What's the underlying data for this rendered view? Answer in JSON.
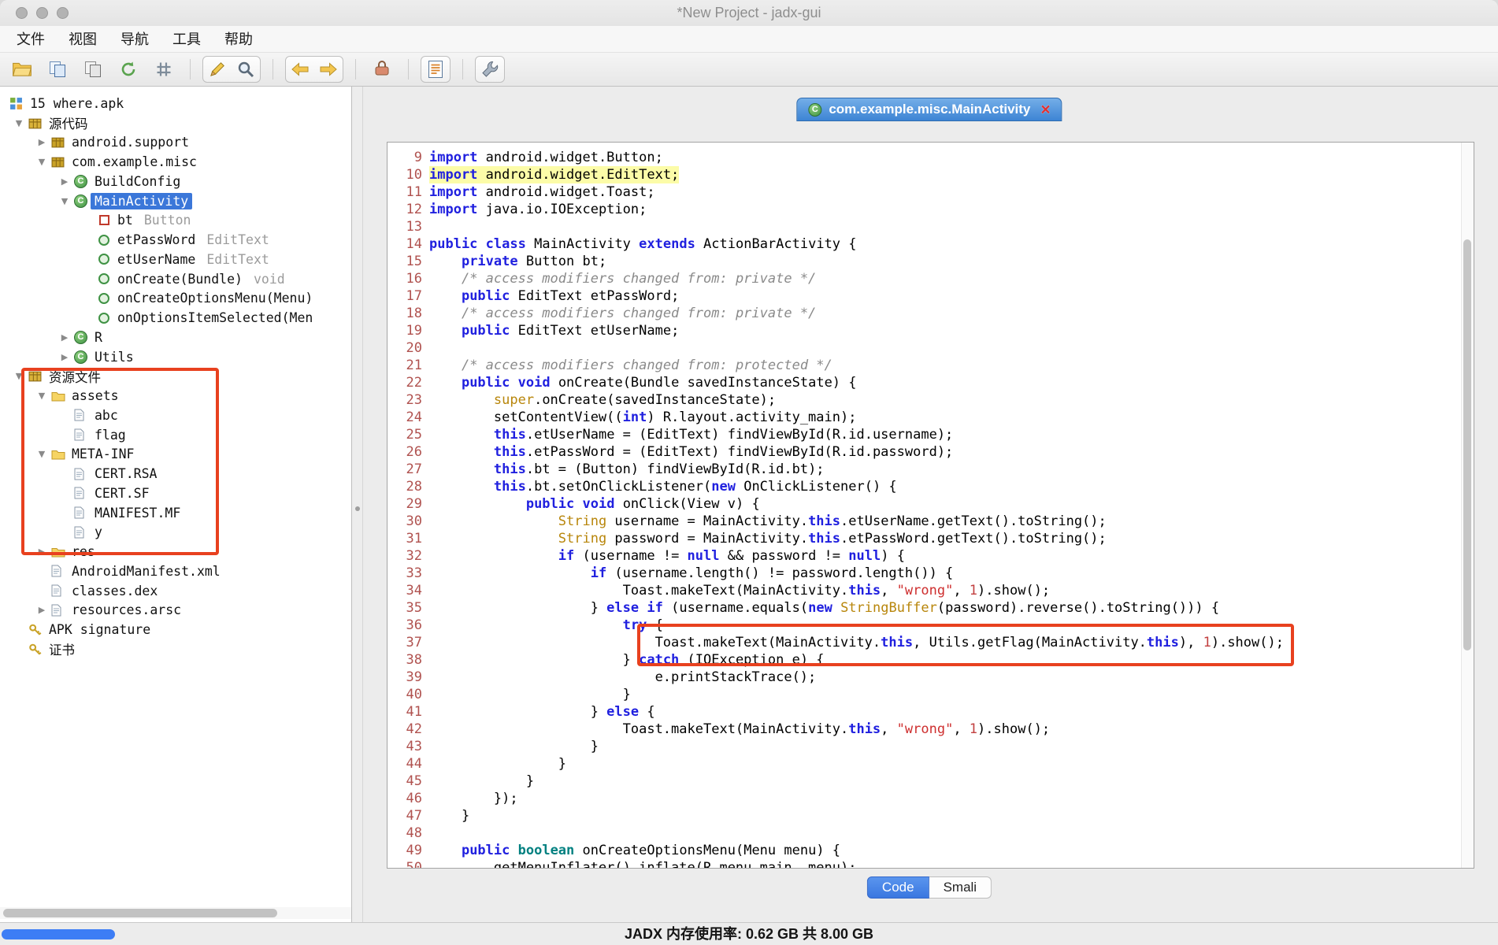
{
  "window": {
    "title": "*New Project - jadx-gui"
  },
  "menubar": {
    "items": [
      "文件",
      "视图",
      "导航",
      "工具",
      "帮助"
    ]
  },
  "toolbar": {
    "items": [
      {
        "name": "open-file-button",
        "icon": "folder"
      },
      {
        "name": "save-all-button",
        "icon": "save-all"
      },
      {
        "name": "export-button",
        "icon": "export"
      },
      {
        "name": "reload-button",
        "icon": "sync"
      },
      {
        "name": "flatten-packages-button",
        "icon": "flatten"
      },
      {
        "sep": true
      },
      {
        "name": "deobfuscation-button",
        "icon": "pencil",
        "group": "edit"
      },
      {
        "name": "search-button",
        "icon": "search",
        "group": "edit"
      },
      {
        "sep": true
      },
      {
        "name": "back-button",
        "icon": "arrow-left",
        "group": "nav"
      },
      {
        "name": "forward-button",
        "icon": "arrow-right",
        "group": "nav"
      },
      {
        "sep": true
      },
      {
        "name": "quark-button",
        "icon": "bag"
      },
      {
        "sep": true
      },
      {
        "name": "log-viewer-button",
        "icon": "log",
        "group": "log"
      },
      {
        "sep": true
      },
      {
        "name": "preferences-button",
        "icon": "wrench",
        "group": "prefs"
      }
    ]
  },
  "tree": {
    "items": [
      {
        "label": "15 where.apk",
        "level": 0,
        "icon": "apk",
        "root": true
      },
      {
        "label": "源代码",
        "level": 0,
        "icon": "source-package",
        "arrow": "open"
      },
      {
        "label": "android.support",
        "level": 1,
        "icon": "package",
        "arrow": "closed"
      },
      {
        "label": "com.example.misc",
        "level": 1,
        "icon": "package",
        "arrow": "open"
      },
      {
        "label": "BuildConfig",
        "level": 2,
        "icon": "class",
        "arrow": "closed"
      },
      {
        "label": "MainActivity",
        "level": 2,
        "icon": "class",
        "arrow": "open",
        "selected": true
      },
      {
        "label": "bt",
        "sub": "Button",
        "level": 3,
        "icon": "field"
      },
      {
        "label": "etPassWord",
        "sub": "EditText",
        "level": 3,
        "icon": "method"
      },
      {
        "label": "etUserName",
        "sub": "EditText",
        "level": 3,
        "icon": "method"
      },
      {
        "label": "onCreate(Bundle)",
        "sub": "void",
        "level": 3,
        "icon": "method"
      },
      {
        "label": "onCreateOptionsMenu(Menu)",
        "level": 3,
        "icon": "method"
      },
      {
        "label": "onOptionsItemSelected(Men",
        "level": 3,
        "icon": "method"
      },
      {
        "label": "R",
        "level": 2,
        "icon": "class",
        "arrow": "closed"
      },
      {
        "label": "Utils",
        "level": 2,
        "icon": "class",
        "arrow": "closed"
      },
      {
        "label": "资源文件",
        "level": 0,
        "icon": "resource-package",
        "arrow": "open"
      },
      {
        "label": "assets",
        "level": 1,
        "icon": "folder",
        "arrow": "open"
      },
      {
        "label": "abc",
        "level": 2,
        "icon": "file"
      },
      {
        "label": "flag",
        "level": 2,
        "icon": "file"
      },
      {
        "label": "META-INF",
        "level": 1,
        "icon": "folder",
        "arrow": "open"
      },
      {
        "label": "CERT.RSA",
        "level": 2,
        "icon": "file"
      },
      {
        "label": "CERT.SF",
        "level": 2,
        "icon": "file"
      },
      {
        "label": "MANIFEST.MF",
        "level": 2,
        "icon": "file"
      },
      {
        "label": "y",
        "level": 2,
        "icon": "file"
      },
      {
        "label": "res",
        "level": 1,
        "icon": "folder",
        "arrow": "closed"
      },
      {
        "label": "AndroidManifest.xml",
        "level": 1,
        "icon": "file"
      },
      {
        "label": "classes.dex",
        "level": 1,
        "icon": "file"
      },
      {
        "label": "resources.arsc",
        "level": 1,
        "icon": "file",
        "arrow": "closed"
      },
      {
        "label": "APK signature",
        "level": 0,
        "icon": "key"
      },
      {
        "label": "证书",
        "level": 0,
        "icon": "key"
      }
    ]
  },
  "editor": {
    "tab_title": "com.example.misc.MainActivity",
    "close_icon": "×",
    "buttons": {
      "code": "Code",
      "smali": "Smali"
    },
    "lines": [
      {
        "n": 9,
        "seg": [
          [
            "k",
            "import"
          ],
          [
            "p",
            " android.widget.Button;"
          ]
        ]
      },
      {
        "n": 10,
        "hl": true,
        "seg": [
          [
            "k",
            "import"
          ],
          [
            "p",
            " android.widget.EditText;"
          ]
        ]
      },
      {
        "n": 11,
        "seg": [
          [
            "k",
            "import"
          ],
          [
            "p",
            " android.widget.Toast;"
          ]
        ]
      },
      {
        "n": 12,
        "seg": [
          [
            "k",
            "import"
          ],
          [
            "p",
            " java.io.IOException;"
          ]
        ]
      },
      {
        "n": 13,
        "seg": []
      },
      {
        "n": 14,
        "seg": [
          [
            "k",
            "public"
          ],
          [
            "p",
            " "
          ],
          [
            "k",
            "class"
          ],
          [
            "p",
            " MainActivity "
          ],
          [
            "k",
            "extends"
          ],
          [
            "p",
            " ActionBarActivity {"
          ]
        ]
      },
      {
        "n": 15,
        "seg": [
          [
            "p",
            "    "
          ],
          [
            "k",
            "private"
          ],
          [
            "p",
            " Button bt;"
          ]
        ]
      },
      {
        "n": 16,
        "seg": [
          [
            "p",
            "    "
          ],
          [
            "c",
            "/* access modifiers changed from: private */"
          ]
        ]
      },
      {
        "n": 17,
        "seg": [
          [
            "p",
            "    "
          ],
          [
            "k",
            "public"
          ],
          [
            "p",
            " EditText etPassWord;"
          ]
        ]
      },
      {
        "n": 18,
        "seg": [
          [
            "p",
            "    "
          ],
          [
            "c",
            "/* access modifiers changed from: private */"
          ]
        ]
      },
      {
        "n": 19,
        "seg": [
          [
            "p",
            "    "
          ],
          [
            "k",
            "public"
          ],
          [
            "p",
            " EditText etUserName;"
          ]
        ]
      },
      {
        "n": 20,
        "seg": []
      },
      {
        "n": 21,
        "seg": [
          [
            "p",
            "    "
          ],
          [
            "c",
            "/* access modifiers changed from: protected */"
          ]
        ]
      },
      {
        "n": 22,
        "seg": [
          [
            "p",
            "    "
          ],
          [
            "k",
            "public"
          ],
          [
            "p",
            " "
          ],
          [
            "k",
            "void"
          ],
          [
            "p",
            " onCreate(Bundle savedInstanceState) {"
          ]
        ]
      },
      {
        "n": 23,
        "seg": [
          [
            "p",
            "        "
          ],
          [
            "t",
            "super"
          ],
          [
            "p",
            ".onCreate(savedInstanceState);"
          ]
        ]
      },
      {
        "n": 24,
        "seg": [
          [
            "p",
            "        setContentView(("
          ],
          [
            "k",
            "int"
          ],
          [
            "p",
            ") R.layout.activity_main);"
          ]
        ]
      },
      {
        "n": 25,
        "seg": [
          [
            "p",
            "        "
          ],
          [
            "k",
            "this"
          ],
          [
            "p",
            ".etUserName = (EditText) findViewById(R.id.username);"
          ]
        ]
      },
      {
        "n": 26,
        "seg": [
          [
            "p",
            "        "
          ],
          [
            "k",
            "this"
          ],
          [
            "p",
            ".etPassWord = (EditText) findViewById(R.id.password);"
          ]
        ]
      },
      {
        "n": 27,
        "seg": [
          [
            "p",
            "        "
          ],
          [
            "k",
            "this"
          ],
          [
            "p",
            ".bt = (Button) findViewById(R.id.bt);"
          ]
        ]
      },
      {
        "n": 28,
        "seg": [
          [
            "p",
            "        "
          ],
          [
            "k",
            "this"
          ],
          [
            "p",
            ".bt.setOnClickListener("
          ],
          [
            "k",
            "new"
          ],
          [
            "p",
            " OnClickListener() {"
          ]
        ]
      },
      {
        "n": 29,
        "seg": [
          [
            "p",
            "            "
          ],
          [
            "k",
            "public"
          ],
          [
            "p",
            " "
          ],
          [
            "k",
            "void"
          ],
          [
            "p",
            " onClick(View v) {"
          ]
        ]
      },
      {
        "n": 30,
        "seg": [
          [
            "p",
            "                "
          ],
          [
            "t",
            "String"
          ],
          [
            "p",
            " username = MainActivity."
          ],
          [
            "k",
            "this"
          ],
          [
            "p",
            ".etUserName.getText().toString();"
          ]
        ]
      },
      {
        "n": 31,
        "seg": [
          [
            "p",
            "                "
          ],
          [
            "t",
            "String"
          ],
          [
            "p",
            " password = MainActivity."
          ],
          [
            "k",
            "this"
          ],
          [
            "p",
            ".etPassWord.getText().toString();"
          ]
        ]
      },
      {
        "n": 32,
        "seg": [
          [
            "p",
            "                "
          ],
          [
            "k",
            "if"
          ],
          [
            "p",
            " (username != "
          ],
          [
            "k",
            "null"
          ],
          [
            "p",
            " && password != "
          ],
          [
            "k",
            "null"
          ],
          [
            "p",
            ") {"
          ]
        ]
      },
      {
        "n": 33,
        "seg": [
          [
            "p",
            "                    "
          ],
          [
            "k",
            "if"
          ],
          [
            "p",
            " (username.length() != password.length()) {"
          ]
        ]
      },
      {
        "n": 34,
        "seg": [
          [
            "p",
            "                        Toast.makeText(MainActivity."
          ],
          [
            "k",
            "this"
          ],
          [
            "p",
            ", "
          ],
          [
            "s",
            "\"wrong\""
          ],
          [
            "p",
            ", "
          ],
          [
            "n",
            "1"
          ],
          [
            "p",
            ").show();"
          ]
        ]
      },
      {
        "n": 35,
        "seg": [
          [
            "p",
            "                    } "
          ],
          [
            "k",
            "else"
          ],
          [
            "p",
            " "
          ],
          [
            "k",
            "if"
          ],
          [
            "p",
            " (username.equals("
          ],
          [
            "k",
            "new"
          ],
          [
            "p",
            " "
          ],
          [
            "t",
            "StringBuffer"
          ],
          [
            "p",
            "(password).reverse().toString())) {"
          ]
        ]
      },
      {
        "n": 36,
        "seg": [
          [
            "p",
            "                        "
          ],
          [
            "k",
            "try"
          ],
          [
            "p",
            " {"
          ]
        ]
      },
      {
        "n": 37,
        "seg": [
          [
            "p",
            "                            Toast.makeText(MainActivity."
          ],
          [
            "k",
            "this"
          ],
          [
            "p",
            ", Utils.getFlag(MainActivity."
          ],
          [
            "k",
            "this"
          ],
          [
            "p",
            "), "
          ],
          [
            "n",
            "1"
          ],
          [
            "p",
            ").show();"
          ]
        ]
      },
      {
        "n": 38,
        "seg": [
          [
            "p",
            "                        } "
          ],
          [
            "k",
            "catch"
          ],
          [
            "p",
            " (IOException e) {"
          ]
        ]
      },
      {
        "n": 39,
        "seg": [
          [
            "p",
            "                            e.printStackTrace();"
          ]
        ]
      },
      {
        "n": 40,
        "seg": [
          [
            "p",
            "                        }"
          ]
        ]
      },
      {
        "n": 41,
        "seg": [
          [
            "p",
            "                    } "
          ],
          [
            "k",
            "else"
          ],
          [
            "p",
            " {"
          ]
        ]
      },
      {
        "n": 42,
        "seg": [
          [
            "p",
            "                        Toast.makeText(MainActivity."
          ],
          [
            "k",
            "this"
          ],
          [
            "p",
            ", "
          ],
          [
            "s",
            "\"wrong\""
          ],
          [
            "p",
            ", "
          ],
          [
            "n",
            "1"
          ],
          [
            "p",
            ").show();"
          ]
        ]
      },
      {
        "n": 43,
        "seg": [
          [
            "p",
            "                    }"
          ]
        ]
      },
      {
        "n": 44,
        "seg": [
          [
            "p",
            "                }"
          ]
        ]
      },
      {
        "n": 45,
        "seg": [
          [
            "p",
            "            }"
          ]
        ]
      },
      {
        "n": 46,
        "seg": [
          [
            "p",
            "        });"
          ]
        ]
      },
      {
        "n": 47,
        "seg": [
          [
            "p",
            "    }"
          ]
        ]
      },
      {
        "n": 48,
        "seg": []
      },
      {
        "n": 49,
        "seg": [
          [
            "p",
            "    "
          ],
          [
            "k",
            "public"
          ],
          [
            "p",
            " "
          ],
          [
            "d",
            "boolean"
          ],
          [
            "p",
            " onCreateOptionsMenu(Menu menu) {"
          ]
        ]
      },
      {
        "n": 50,
        "seg": [
          [
            "p",
            "        getMenuInflater().inflate(R.menu.main, menu);"
          ]
        ]
      }
    ]
  },
  "statusbar": {
    "text": "JADX 内存使用率: 0.62 GB 共 8.00 GB"
  },
  "colors": {
    "annotation_red": "#E8411F",
    "tab_blue": "#3D84D4",
    "selection_blue": "#3B77D9",
    "highlight_yellow": "#FCFCA8",
    "progress_blue": "#3D7DF5"
  }
}
